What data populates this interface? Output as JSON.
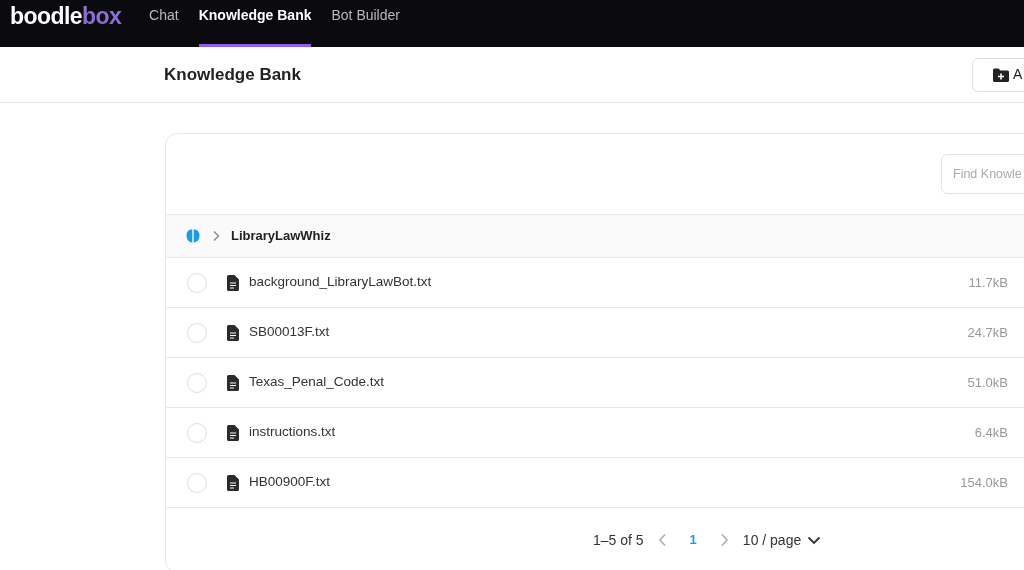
{
  "nav": {
    "logo": {
      "part_1": "boodle",
      "part_2": "box"
    },
    "tabs": [
      {
        "label": "Chat",
        "selected": false
      },
      {
        "label": "Knowledge Bank",
        "selected": true
      },
      {
        "label": "Bot Builder",
        "selected": false
      }
    ]
  },
  "header": {
    "title": "Knowledge Bank",
    "button": "A"
  },
  "search": {
    "placeholder": "Find Knowle"
  },
  "folder": {
    "name": "LibraryLawWhiz",
    "expanded": false
  },
  "files": [
    {
      "name": "background_LibraryLawBot.txt",
      "size": "11.7kB",
      "selected": false
    },
    {
      "name": "SB00013F.txt",
      "size": "24.7kB",
      "selected": false
    },
    {
      "name": "Texas_Penal_Code.txt",
      "size": "51.0kB",
      "selected": false
    },
    {
      "name": "instructions.txt",
      "size": "6.4kB",
      "selected": false
    },
    {
      "name": "HB00900F.txt",
      "size": "154.0kB",
      "selected": false
    }
  ],
  "pagination": {
    "range": "1–5 of 5",
    "pages": [
      {
        "label": "1",
        "selected": true
      }
    ],
    "page_size": "10 / page"
  }
}
